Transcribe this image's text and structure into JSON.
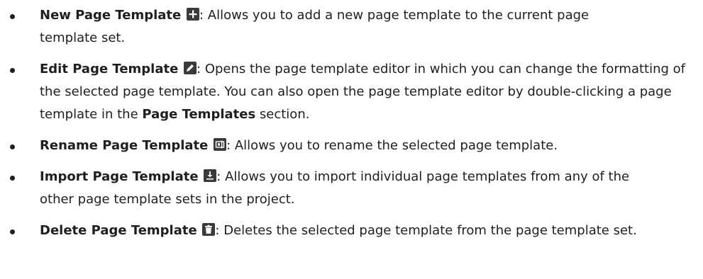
{
  "items": [
    {
      "term": "New Page Template",
      "icon": "plus-icon",
      "text": ": Allows you to add a new page template to the current page template set."
    },
    {
      "term": "Edit Page Template",
      "icon": "pencil-icon",
      "text_before": ": Opens the page template editor in which you can change the formatting of the selected page template. You can also open the page template editor by double-clicking a page template in the ",
      "bold": "Page Templates",
      "text_after": " section."
    },
    {
      "term": "Rename Page Template",
      "icon": "rename-icon",
      "text": ": Allows you to rename the selected page template."
    },
    {
      "term": "Import Page Template",
      "icon": "import-icon",
      "text": ": Allows you to import individual page templates from any of the other page template sets in the project."
    },
    {
      "term": "Delete Page Template",
      "icon": "trash-icon",
      "text": ": Deletes the selected page template from the page template set."
    }
  ]
}
